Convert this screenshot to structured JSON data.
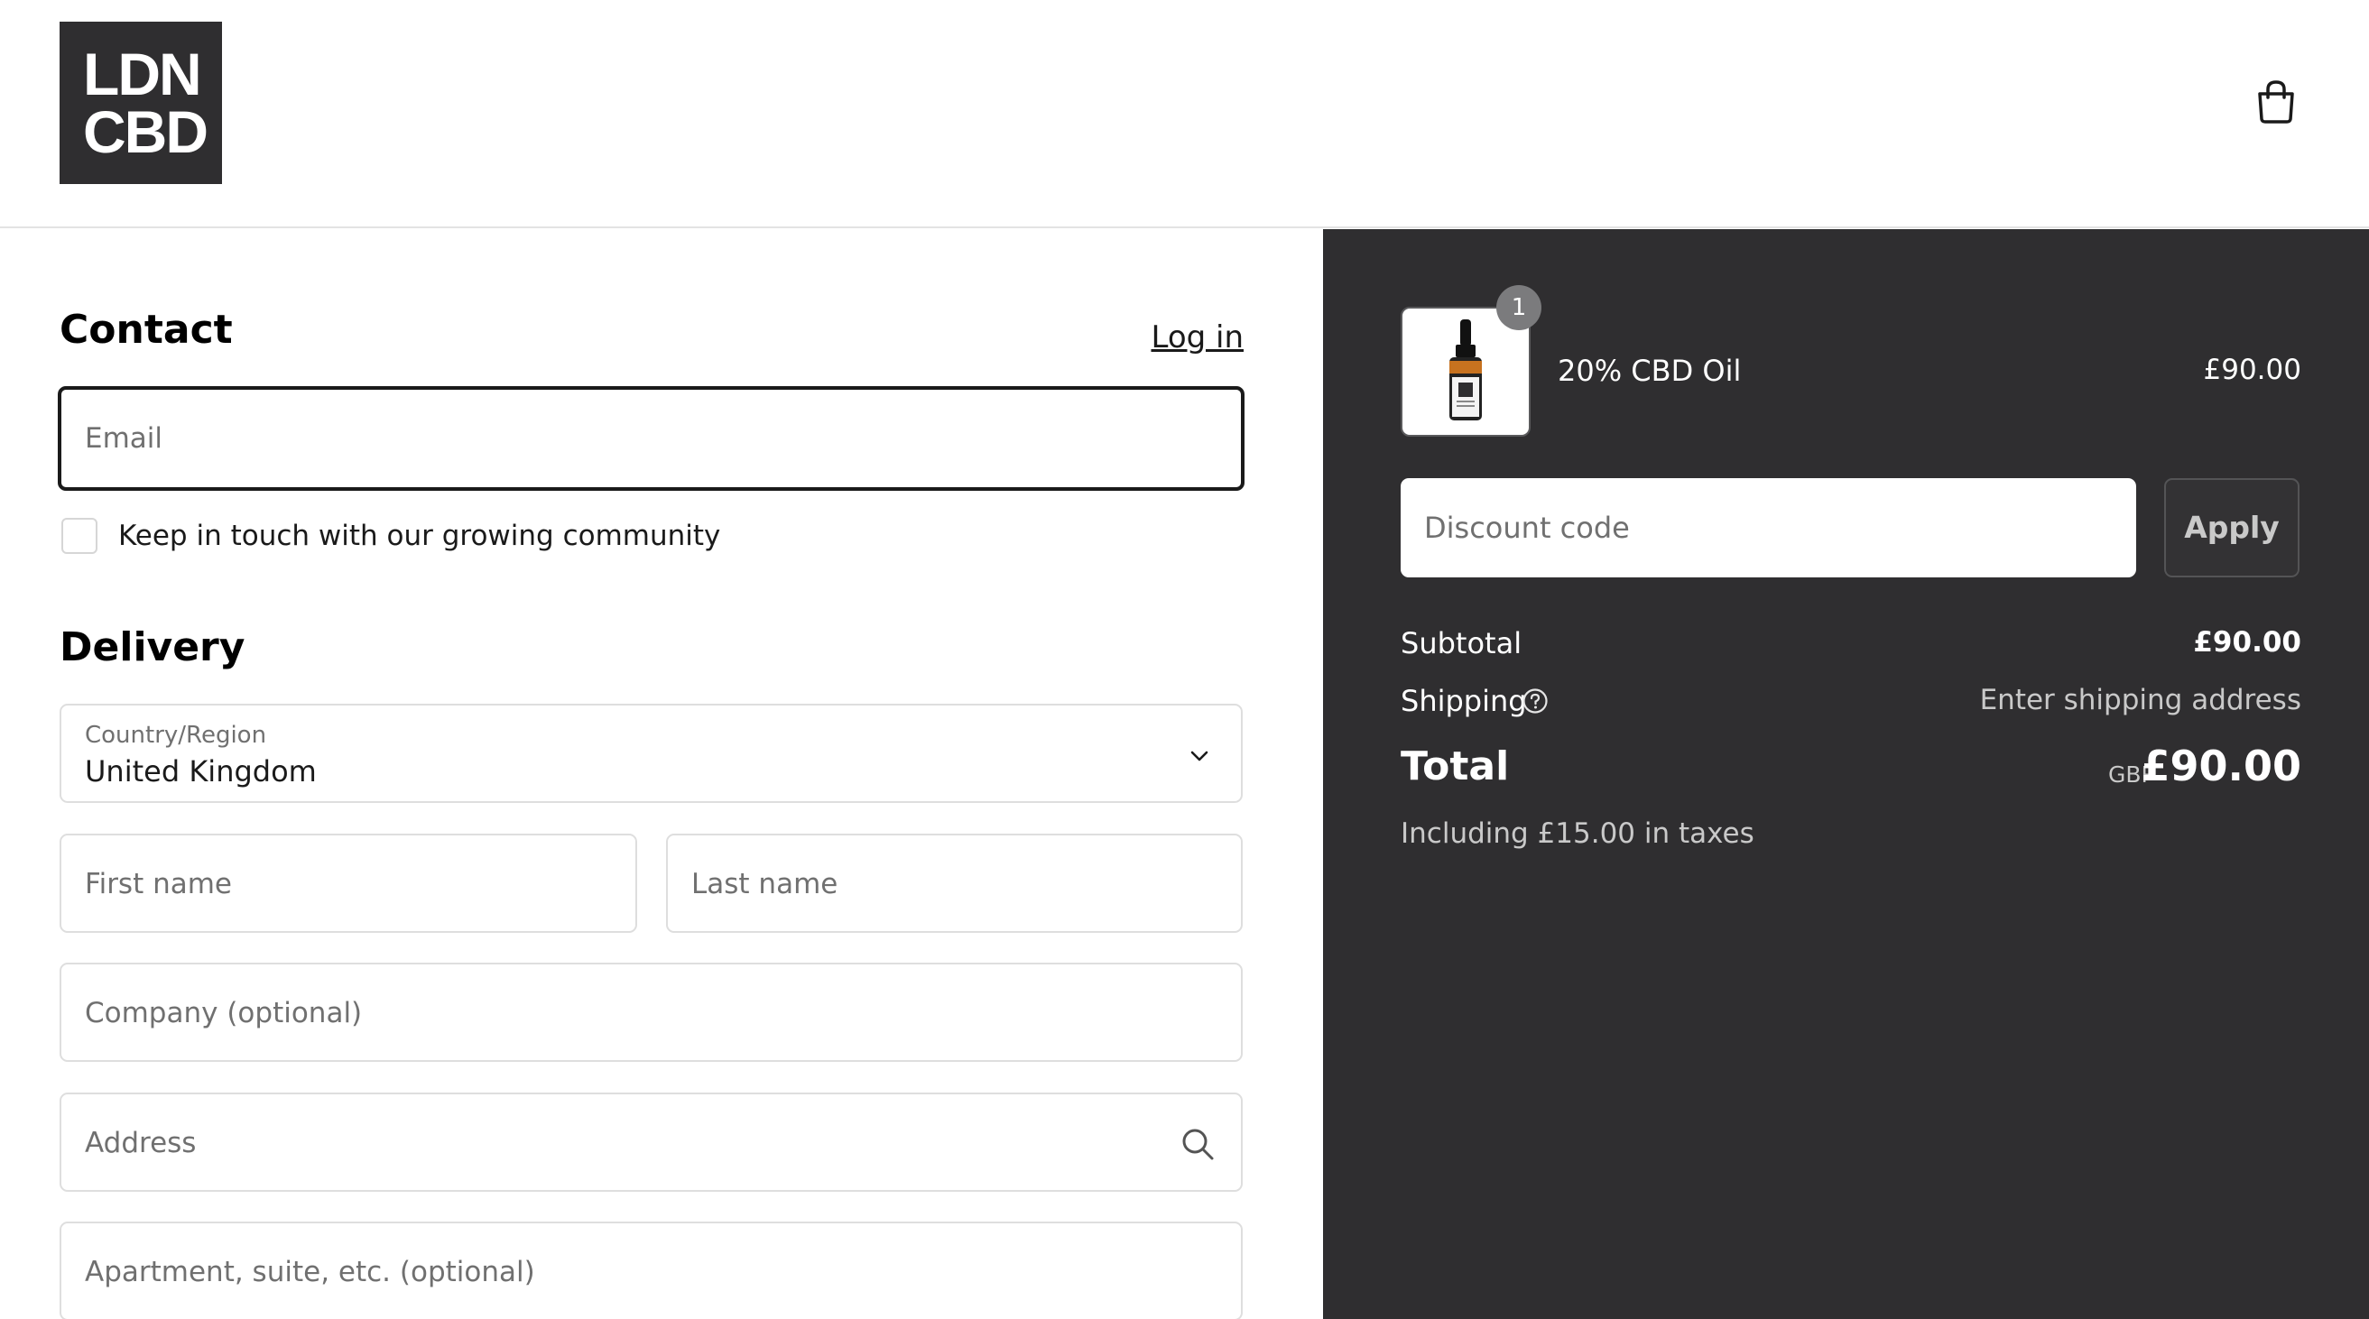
{
  "header": {
    "logo_line1": "LDN",
    "logo_line2": "CBD",
    "cart_icon": "shopping-bag-icon"
  },
  "contact": {
    "title": "Contact",
    "login_label": "Log in",
    "email_placeholder": "Email",
    "marketing_label": "Keep in touch with our growing community",
    "marketing_checked": false
  },
  "delivery": {
    "title": "Delivery",
    "country_label": "Country/Region",
    "country_value": "United Kingdom",
    "first_name_placeholder": "First name",
    "last_name_placeholder": "Last name",
    "company_placeholder": "Company (optional)",
    "address_placeholder": "Address",
    "apartment_placeholder": "Apartment, suite, etc. (optional)"
  },
  "summary": {
    "item": {
      "quantity": "1",
      "name": "20% CBD Oil",
      "price": "£90.00"
    },
    "discount_placeholder": "Discount code",
    "apply_label": "Apply",
    "subtotal_label": "Subtotal",
    "subtotal_value": "£90.00",
    "shipping_label": "Shipping",
    "shipping_value": "Enter shipping address",
    "total_label": "Total",
    "total_currency": "GBP",
    "total_value": "£90.00",
    "taxes_note": "Including £15.00 in taxes"
  },
  "colors": {
    "summary_bg": "#2f2e30",
    "logo_bg": "#2f2e30"
  }
}
